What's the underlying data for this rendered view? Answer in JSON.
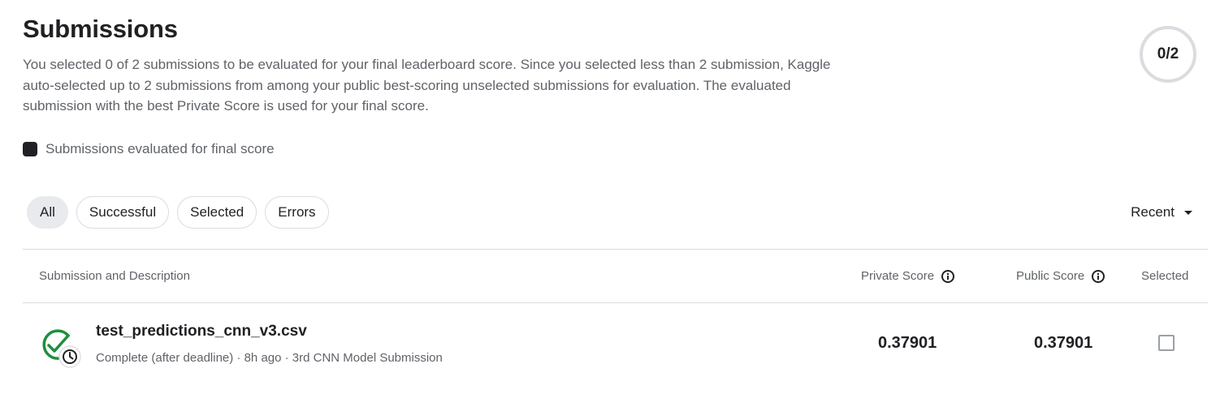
{
  "header": {
    "title": "Submissions",
    "description": "You selected 0 of 2 submissions to be evaluated for your final leaderboard score. Since you selected less than 2 submission, Kaggle auto-selected up to 2 submissions from among your public best-scoring unselected submissions for evaluation. The evaluated submission with the best Private Score is used for your final score.",
    "selection_counter": "0/2"
  },
  "legend": {
    "label": "Submissions evaluated for final score",
    "swatch_color": "#202124"
  },
  "filters": {
    "chips": [
      {
        "label": "All",
        "active": true
      },
      {
        "label": "Successful",
        "active": false
      },
      {
        "label": "Selected",
        "active": false
      },
      {
        "label": "Errors",
        "active": false
      }
    ]
  },
  "sort": {
    "label": "Recent",
    "icon": "caret-down-icon"
  },
  "table": {
    "columns": {
      "submission": "Submission and Description",
      "private_score": "Private Score",
      "public_score": "Public Score",
      "selected": "Selected"
    },
    "rows": [
      {
        "file_name": "test_predictions_cnn_v3.csv",
        "meta": "Complete (after deadline) · 8h ago · 3rd CNN Model Submission",
        "private_score": "0.37901",
        "public_score": "0.37901",
        "selected": false,
        "status_icon": "check-circle-clock-icon",
        "status_color": "#1e8e3e"
      }
    ]
  }
}
